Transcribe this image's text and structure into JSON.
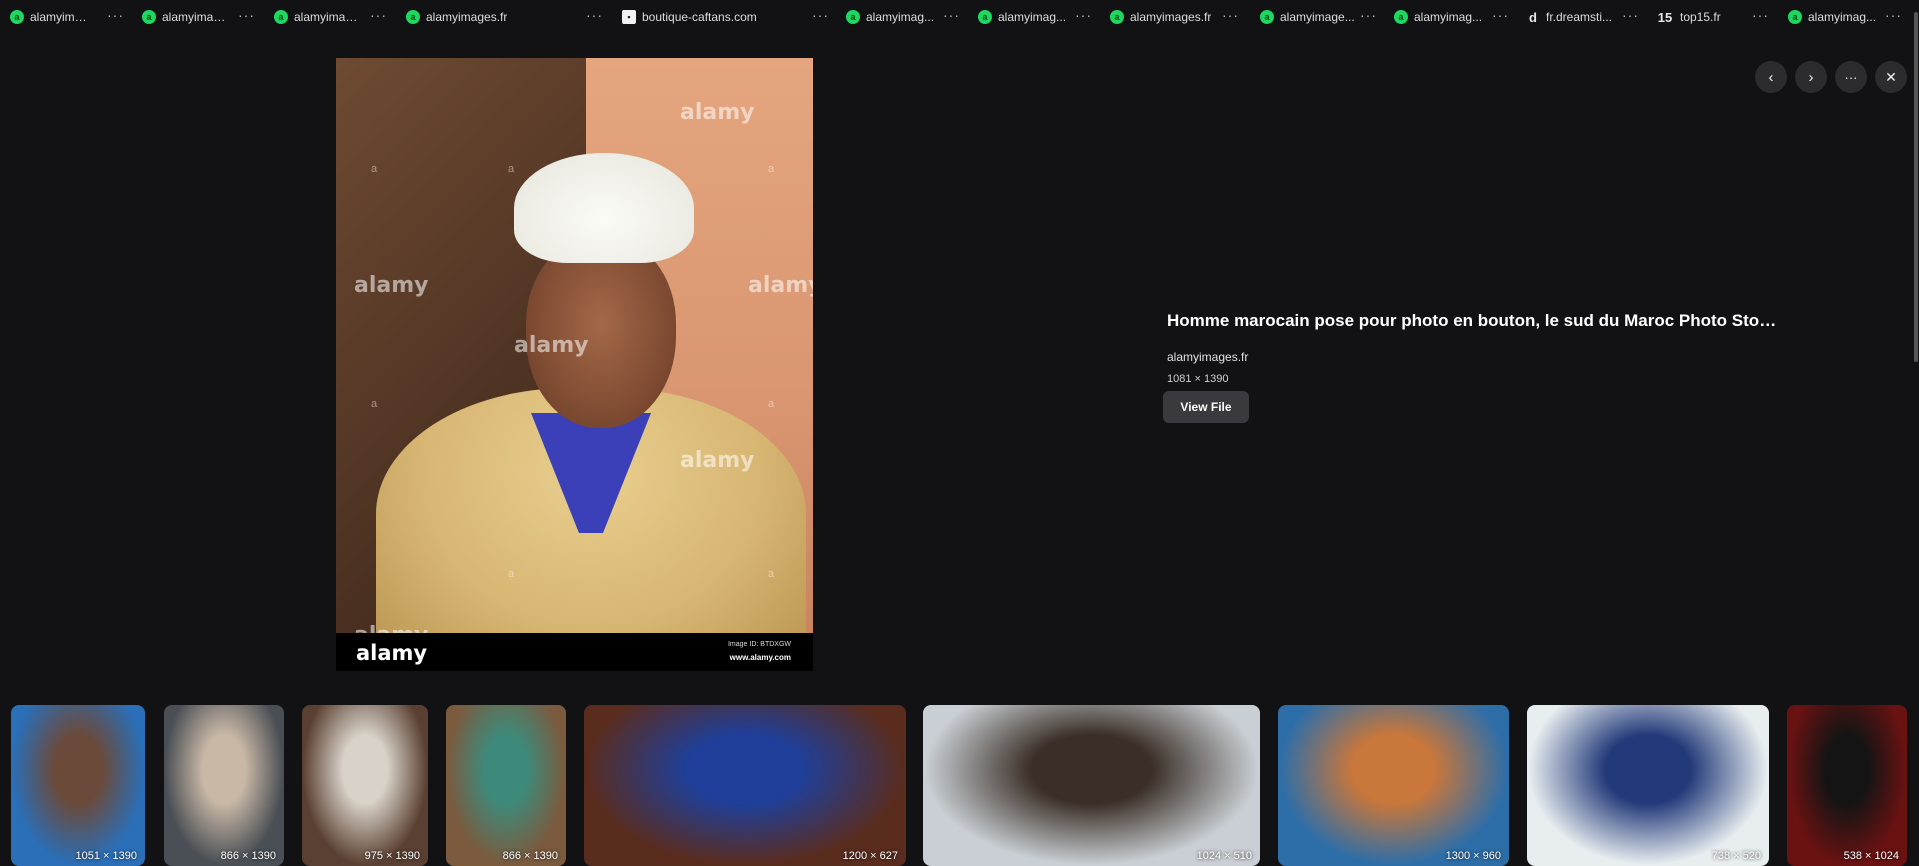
{
  "sources": [
    {
      "label": "alamyimag...",
      "icon": "alamy-favicon-icon"
    },
    {
      "label": "alamyimag...",
      "icon": "alamy-favicon-icon"
    },
    {
      "label": "alamyimag...",
      "icon": "alamy-favicon-icon"
    },
    {
      "label": "alamyimages.fr",
      "icon": "alamy-favicon-icon"
    },
    {
      "label": "boutique-caftans.com",
      "icon": "boutique-favicon-icon"
    },
    {
      "label": "alamyimag...",
      "icon": "alamy-favicon-icon"
    },
    {
      "label": "alamyimag...",
      "icon": "alamy-favicon-icon"
    },
    {
      "label": "alamyimages.fr",
      "icon": "alamy-favicon-icon"
    },
    {
      "label": "alamyimage...",
      "icon": "alamy-favicon-icon"
    },
    {
      "label": "alamyimag...",
      "icon": "alamy-favicon-icon"
    },
    {
      "label": "fr.dreamsti...",
      "icon": "dreamstime-favicon-icon"
    },
    {
      "label": "top15.fr",
      "icon": "top15-favicon-icon",
      "badge": "15"
    },
    {
      "label": "alamyimag...",
      "icon": "alamy-favicon-icon"
    }
  ],
  "more_glyph": "···",
  "preview": {
    "watermark": "alamy",
    "watermark_small": "a",
    "footer_logo": "alamy",
    "footer_id": "Image ID: BTDXGW",
    "footer_url": "www.alamy.com"
  },
  "controls": {
    "prev_icon": "chevron-left-icon",
    "next_icon": "chevron-right-icon",
    "more_icon": "more-horizontal-icon",
    "close_icon": "close-icon",
    "prev_glyph": "‹",
    "next_glyph": "›",
    "more_glyph": "···",
    "close_glyph": "✕"
  },
  "details": {
    "title": "Homme marocain pose pour photo en bouton, le sud du Maroc Photo Stock ...",
    "source": "alamyimages.fr",
    "dimensions": "1081 × 1390",
    "view_file_label": "View File"
  },
  "related": [
    {
      "dims": "1051 × 1390",
      "color_a": "#2a6fb8",
      "color_b": "#6b4a3a"
    },
    {
      "dims": "866 × 1390",
      "color_a": "#4a4f55",
      "color_b": "#c9b8a6"
    },
    {
      "dims": "975 × 1390",
      "color_a": "#5a4032",
      "color_b": "#d8d2c8"
    },
    {
      "dims": "866 × 1390",
      "color_a": "#7b5a3e",
      "color_b": "#3e8a7a"
    },
    {
      "dims": "1200 × 627",
      "color_a": "#5a2c1e",
      "color_b": "#1f3f9a"
    },
    {
      "dims": "1024 × 510",
      "color_a": "#c9cfd4",
      "color_b": "#3a2e26"
    },
    {
      "dims": "1300 × 960",
      "color_a": "#2d6ea8",
      "color_b": "#c9773a"
    },
    {
      "dims": "738 × 520",
      "color_a": "#e8eef0",
      "color_b": "#233a7a"
    },
    {
      "dims": "538 × 1024",
      "color_a": "#6a1212",
      "color_b": "#141414"
    }
  ]
}
